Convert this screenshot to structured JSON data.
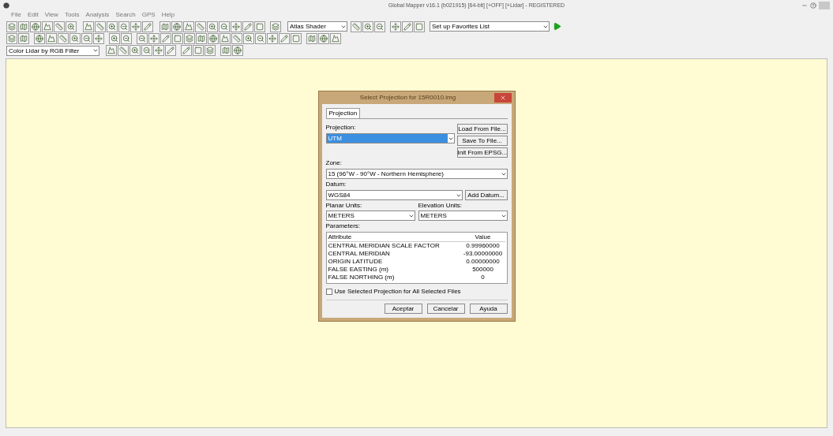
{
  "window": {
    "title": "Global Mapper v16.1 (b021915) [64-bit] [+OFF] [+Lidar] - REGISTERED"
  },
  "menu": [
    "File",
    "Edit",
    "View",
    "Tools",
    "Analysis",
    "Search",
    "GPS",
    "Help"
  ],
  "toolbar": {
    "shader": "Atlas Shader",
    "favorites": "Set up Favorites List",
    "lidar": "Color Lidar by RGB Filter"
  },
  "dialog": {
    "title": "Select Projection for 15R0010.img",
    "tabs": [
      {
        "label": "Projection",
        "selected": true
      }
    ],
    "projection_label": "Projection:",
    "projection": "UTM",
    "side_buttons": [
      "Load From File...",
      "Save To File...",
      "Init From EPSG..."
    ],
    "zone_label": "Zone:",
    "zone": "15 (96°W - 90°W - Northern Hemisphere)",
    "datum_label": "Datum:",
    "datum": "WGS84",
    "add_datum": "Add Datum...",
    "planar_label": "Planar Units:",
    "planar": "METERS",
    "elevation_label": "Elevation Units:",
    "elevation": "METERS",
    "parameters_label": "Parameters:",
    "columns": [
      "Attribute",
      "Value"
    ],
    "rows": [
      [
        "CENTRAL MERIDIAN SCALE FACTOR",
        "0.99960000"
      ],
      [
        "CENTRAL MERIDIAN",
        "-93.00000000"
      ],
      [
        "ORIGIN LATITUDE",
        "0.00000000"
      ],
      [
        "FALSE EASTING (m)",
        "500000"
      ],
      [
        "FALSE NORTHING (m)",
        "0"
      ]
    ],
    "use_all": {
      "label": "Use Selected Projection for All Selected Files",
      "checked": false
    },
    "buttons": [
      "Aceptar",
      "Cancelar",
      "Ayuda"
    ]
  }
}
